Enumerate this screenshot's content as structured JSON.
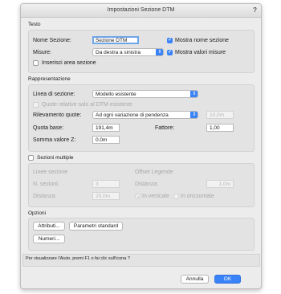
{
  "window": {
    "title": "Impostazioni Sezione DTM",
    "help": "?"
  },
  "testo": {
    "header": "Testo",
    "nome_label": "Nome Sezione:",
    "nome_value": "Sezione DTM",
    "misure_label": "Misure:",
    "misure_value": "Da destra a sinistra",
    "mostra_nome": {
      "label": "Mostra nome sezione",
      "checked": true
    },
    "mostra_valori": {
      "label": "Mostra valori misure",
      "checked": true
    },
    "inserisci_area": {
      "label": "Inserisci area sezione",
      "checked": false
    }
  },
  "rappresentazione": {
    "header": "Rappresentazione",
    "linea_label": "Linea di sezione:",
    "linea_value": "Modello esistente",
    "quote_relative": {
      "label": "Quote relative solo al DTM esistente",
      "checked": false
    },
    "rilevamento_label": "Rilevamento quote:",
    "rilevamento_value": "Ad ogni variazione di pendenza",
    "rilevamento_extra": "10,0m",
    "quota_base_label": "Quota base:",
    "quota_base_value": "191,4m",
    "fattore_label": "Fattore:",
    "fattore_value": "1,00",
    "somma_label": "Somma valore Z:",
    "somma_value": "0,0m"
  },
  "sezioni_multiple": {
    "checkbox": {
      "label": "Sezioni multiple",
      "checked": false
    },
    "linee_header": "Linee sezione",
    "offset_header": "Offset Legende",
    "n_sezioni_label": "N. sezioni:",
    "n_sezioni_value": "3",
    "distanza_label": "Distanza:",
    "distanza_value": "20,0m",
    "offset_distanza_label": "Distanza:",
    "offset_distanza_value": "1,0m",
    "radio_verticale": "In verticale",
    "radio_orizzontale": "In orizzontale"
  },
  "opzioni": {
    "header": "Opzioni",
    "attributi": "Attributi...",
    "parametri": "Parametri standard",
    "numeri": "Numeri..."
  },
  "help_text": "Per visualizzare l'Aiuto, premi F1 o fai clic sull'icona ?",
  "buttons": {
    "cancel": "Annulla",
    "ok": "OK"
  },
  "colors": {
    "accent": "#3a82f7",
    "focus_ring": "#6ea6e8"
  }
}
